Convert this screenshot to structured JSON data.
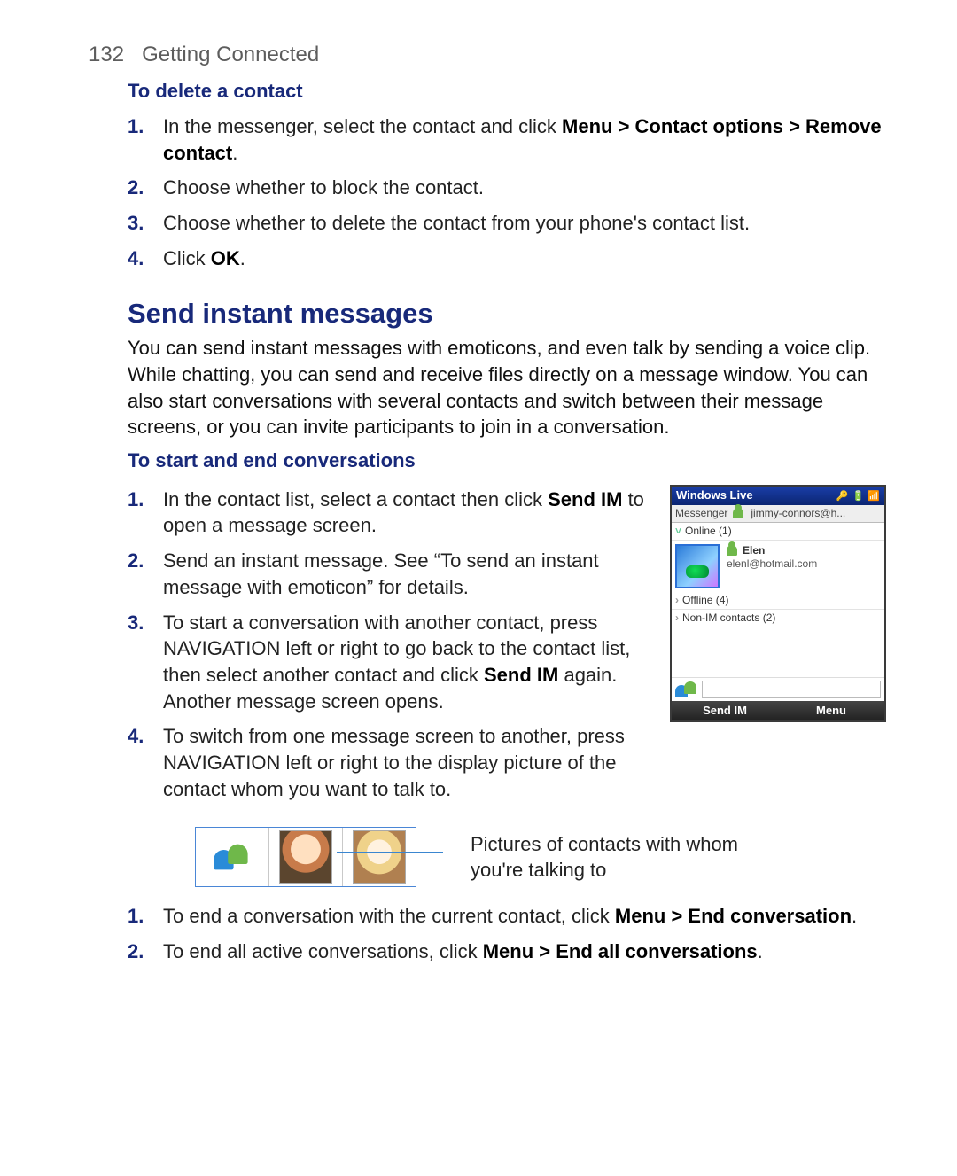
{
  "page": {
    "number": "132",
    "chapter": "Getting Connected"
  },
  "delete_contact": {
    "heading": "To delete a contact",
    "steps": {
      "s1_pre": "In the messenger, select the contact and click ",
      "s1_bold": "Menu > Contact options > Remove contact",
      "s1_post": ".",
      "s2": "Choose whether to block the contact.",
      "s3": "Choose whether to delete the contact from your phone's contact list.",
      "s4_pre": "Click ",
      "s4_bold": "OK",
      "s4_post": "."
    }
  },
  "send_im": {
    "heading": "Send instant messages",
    "intro": "You can send instant messages with emoticons, and even talk by sending a voice clip. While chatting, you can send and receive files directly on a message window. You can also start conversations with several contacts and switch between their message screens, or you can invite participants to join in a conversation."
  },
  "start_end": {
    "heading": "To start and end conversations",
    "s1_pre": "In the contact list, select a contact then click ",
    "s1_bold": "Send IM",
    "s1_post": " to open a message screen.",
    "s2": "Send an instant message. See “To send an instant message with emoticon” for details.",
    "s3_a": "To start a conversation with another contact, press NAVIGATION left or right to go back to the contact list, then select another contact and click ",
    "s3_bold": "Send IM",
    "s3_b": " again. Another message screen opens.",
    "s4": "To switch from one message screen to another, press NAVIGATION left or right to the display picture of the contact whom you want to talk to.",
    "s5_pre": "To end a conversation with the current contact, click ",
    "s5_bold": "Menu > End conversation",
    "s5_post": ".",
    "s6_pre": "To end all active conversations, click ",
    "s6_bold": "Menu > End all conversations",
    "s6_post": "."
  },
  "phone": {
    "title": "Windows Live",
    "tab_label": "Messenger",
    "account": "jimmy-connors@h...",
    "groups": {
      "online": "Online (1)",
      "offline": "Offline (4)",
      "nonim": "Non-IM contacts (2)"
    },
    "contact": {
      "name": "Elen",
      "email": "elenl@hotmail.com"
    },
    "softkeys": {
      "left": "Send IM",
      "right": "Menu"
    }
  },
  "strip_caption": "Pictures of contacts with whom you're talking to"
}
